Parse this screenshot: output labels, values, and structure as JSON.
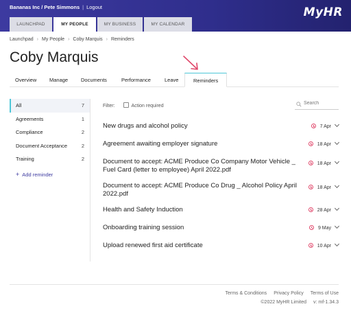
{
  "topbar": {
    "company_user": "Bananas Inc / Pete Simmons",
    "separator": "|",
    "logout": "Logout",
    "logo": "MyHR"
  },
  "nav_tabs": [
    "LAUNCHPAD",
    "MY PEOPLE",
    "MY BUSINESS",
    "MY CALENDAR"
  ],
  "breadcrumb": [
    "Launchpad",
    "My People",
    "Coby Marquis",
    "Reminders"
  ],
  "page_title": "Coby Marquis",
  "sub_tabs": [
    "Overview",
    "Manage",
    "Documents",
    "Performance",
    "Leave",
    "Reminders"
  ],
  "sidebar": {
    "items": [
      {
        "label": "All",
        "count": "7"
      },
      {
        "label": "Agreements",
        "count": "1"
      },
      {
        "label": "Compliance",
        "count": "2"
      },
      {
        "label": "Document Acceptance",
        "count": "2"
      },
      {
        "label": "Training",
        "count": "2"
      }
    ],
    "add_reminder": "Add reminder"
  },
  "filter": {
    "label": "Filter:",
    "action_required": "Action required",
    "search_placeholder": "Search"
  },
  "reminders": [
    {
      "title": "New drugs and alcohol policy",
      "due": "7 Apr"
    },
    {
      "title": "Agreement awaiting employer signature",
      "due": "18 Apr"
    },
    {
      "title": "Document to accept: ACME Produce Co Company Motor Vehicle _ Fuel Card (letter to employee) April 2022.pdf",
      "due": "18 Apr"
    },
    {
      "title": "Document to accept: ACME Produce Co Drug _ Alcohol Policy April 2022.pdf",
      "due": "18 Apr"
    },
    {
      "title": "Health and Safety Induction",
      "due": "28 Apr"
    },
    {
      "title": "Onboarding training session",
      "due": "9 May"
    },
    {
      "title": "Upload renewed first aid certificate",
      "due": "10 Apr"
    }
  ],
  "footer": {
    "links": [
      "Terms & Conditions",
      "Privacy Policy",
      "Terms of Use"
    ],
    "copyright": "©2022 MyHR Limited",
    "version": "v: mf-1.34.3"
  },
  "colors": {
    "brand": "#3d3aa0",
    "accent": "#4cc6d8",
    "arrow": "#e0486b"
  }
}
